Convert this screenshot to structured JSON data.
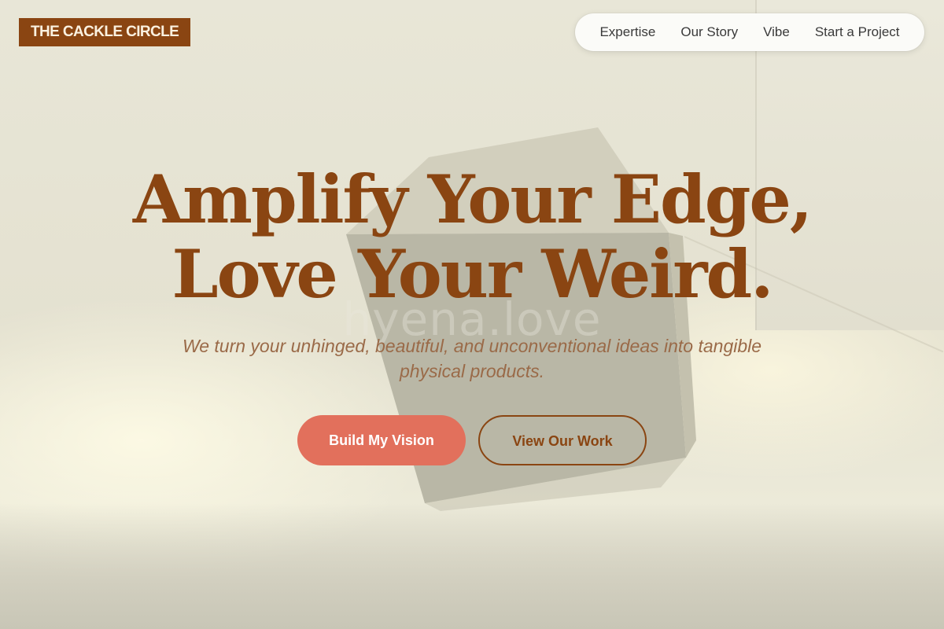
{
  "brand": {
    "logo_text": "THE CACKLE CIRCLE"
  },
  "nav": {
    "items": [
      {
        "label": "Expertise"
      },
      {
        "label": "Our Story"
      },
      {
        "label": "Vibe"
      },
      {
        "label": "Start a Project"
      }
    ]
  },
  "hero": {
    "headline_line1": "Amplify Your Edge,",
    "headline_line2": "Love Your Weird.",
    "subtitle": "We turn your unhinged, beautiful, and unconventional ideas into tangible physical products.",
    "watermark_text": "hyena.love",
    "primary_cta": "Build My Vision",
    "secondary_cta": "View Our Work"
  },
  "colors": {
    "brand_brown": "#8a4512",
    "cta_coral": "#e2705c",
    "background_cream": "#e9e6d6"
  }
}
